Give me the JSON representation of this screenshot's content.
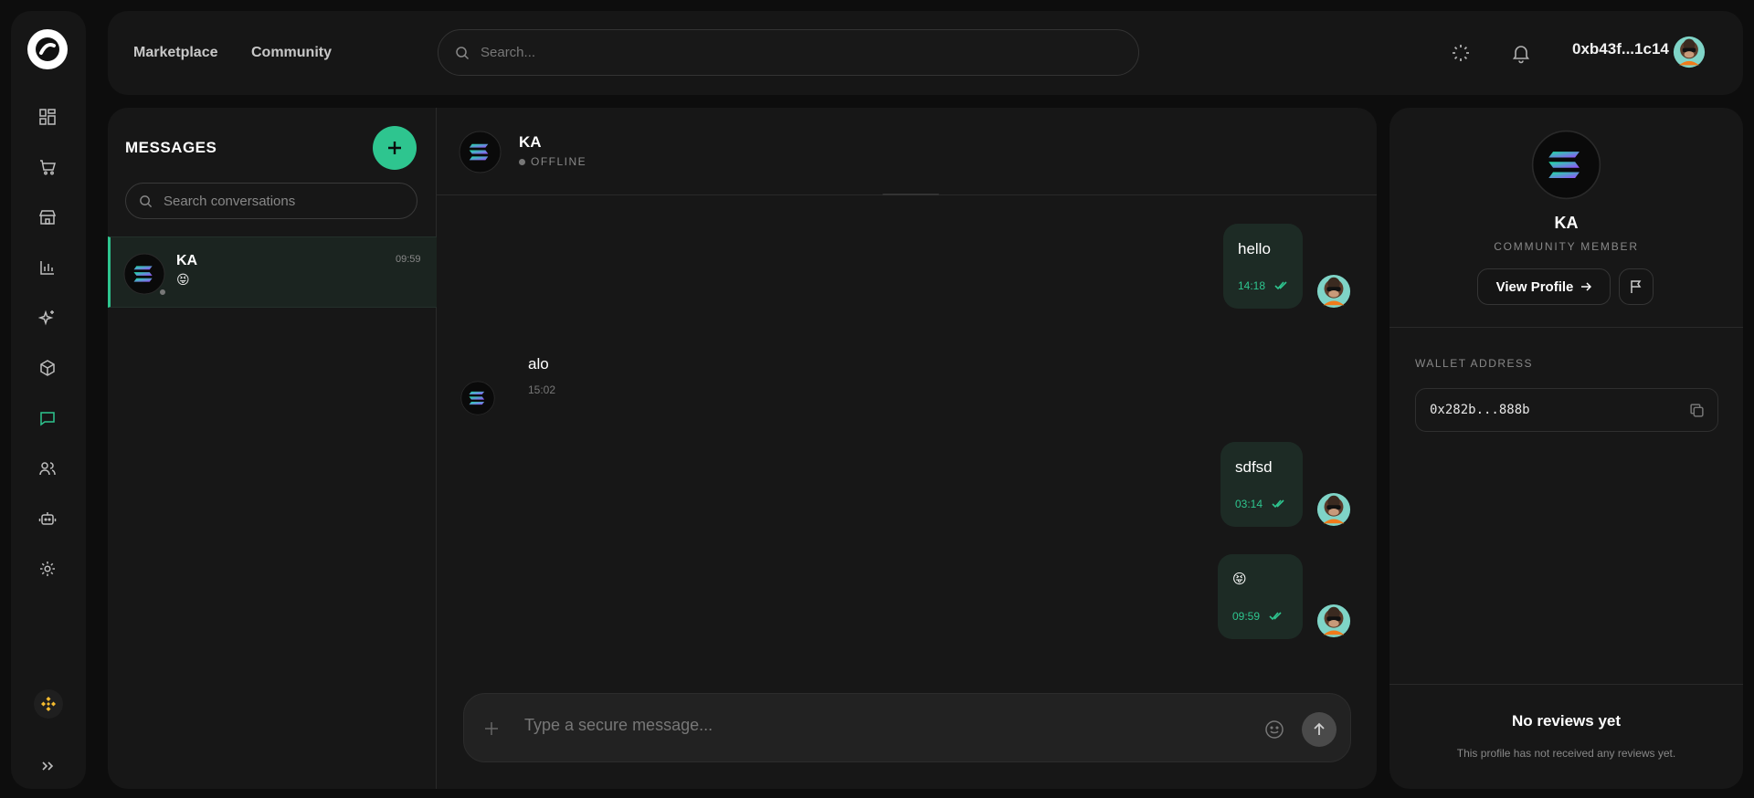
{
  "nav": {
    "marketplace": "Marketplace",
    "community": "Community"
  },
  "search": {
    "placeholder": "Search..."
  },
  "user": {
    "wallet": "0xb43f...1c14"
  },
  "sidebar": {
    "items": [
      "dashboard-icon",
      "cart-icon",
      "store-icon",
      "chart-icon",
      "sparkles-icon",
      "cube-icon",
      "messages-icon",
      "users-icon",
      "bot-icon",
      "settings-icon"
    ],
    "active": "messages-icon"
  },
  "messages": {
    "title": "MESSAGES",
    "search_placeholder": "Search conversations",
    "conversations": [
      {
        "name": "KA",
        "time": "09:59",
        "preview": "😝"
      }
    ]
  },
  "chat": {
    "contact": "KA",
    "status": "OFFLINE",
    "messages": [
      {
        "from": "me",
        "text": "hello",
        "time": "14:18"
      },
      {
        "from": "them",
        "text": "alo",
        "time": "15:02"
      },
      {
        "from": "me",
        "text": "sdfsd",
        "time": "03:14"
      },
      {
        "from": "me",
        "text": "😝",
        "time": "09:59"
      }
    ],
    "composer_placeholder": "Type a secure message..."
  },
  "profile": {
    "name": "KA",
    "role": "COMMUNITY MEMBER",
    "view_profile_label": "View Profile",
    "wallet_label": "WALLET ADDRESS",
    "wallet_address": "0x282b...888b",
    "no_reviews_title": "No reviews yet",
    "no_reviews_text": "This profile has not received any reviews yet."
  },
  "colors": {
    "accent": "#2ec58f",
    "background": "#0d0d0d",
    "panel": "#171717",
    "bubble": "#1d2b25"
  }
}
